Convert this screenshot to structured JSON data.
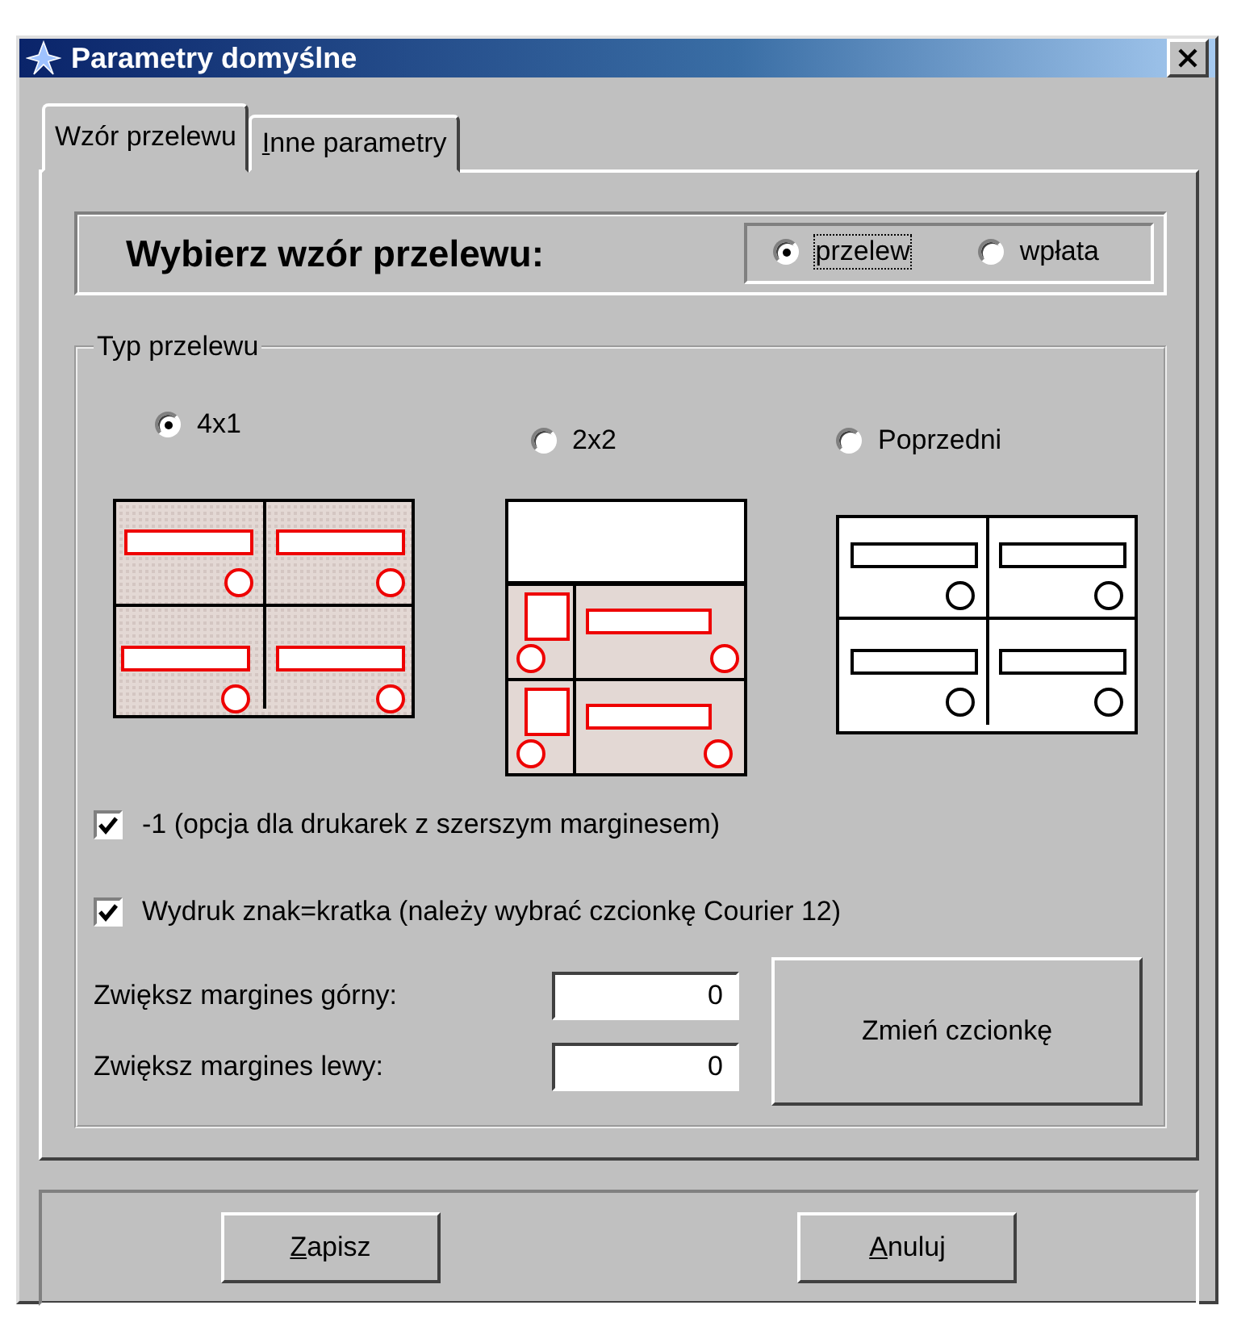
{
  "window": {
    "title": "Parametry domyślne"
  },
  "tabs": [
    {
      "label": "Wzór przelewu",
      "selected": true,
      "underline_first": false
    },
    {
      "label": "Inne parametry",
      "selected": false,
      "underline_first": true
    }
  ],
  "template_choice": {
    "label": "Wybierz wzór przelewu:",
    "options": [
      {
        "label": "przelew",
        "selected": true,
        "focused": true
      },
      {
        "label": "wpłata",
        "selected": false,
        "focused": false
      }
    ]
  },
  "transfer_type": {
    "title": "Typ przelewu",
    "options": [
      {
        "label": "4x1",
        "selected": true,
        "kind": "four"
      },
      {
        "label": "2x2",
        "selected": false,
        "kind": "grid"
      },
      {
        "label": "Poprzedni",
        "selected": false,
        "kind": "previous"
      }
    ]
  },
  "checkboxes": [
    {
      "label": "-1 (opcja dla drukarek z szerszym marginesem)",
      "checked": true
    },
    {
      "label": "Wydruk znak=kratka (należy wybrać czcionkę Courier 12)",
      "checked": true
    }
  ],
  "fields": [
    {
      "label": "Zwiększ margines górny:",
      "value": "0"
    },
    {
      "label": "Zwiększ margines lewy:",
      "value": "0"
    }
  ],
  "font_button": "Zmień czcionkę",
  "buttons": [
    {
      "label": "Zapisz",
      "underline_first": true
    },
    {
      "label": "Anuluj",
      "underline_first": true
    }
  ]
}
